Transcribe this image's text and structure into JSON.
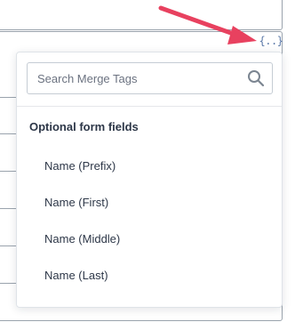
{
  "merge_tags": {
    "trigger_label": "{..}",
    "search": {
      "placeholder": "Search Merge Tags",
      "value": ""
    },
    "group": {
      "label": "Optional form fields",
      "items": [
        {
          "label": "Name (Prefix)"
        },
        {
          "label": "Name (First)"
        },
        {
          "label": "Name (Middle)"
        },
        {
          "label": "Name (Last)"
        }
      ]
    }
  },
  "colors": {
    "annotation_arrow": "#e8415f",
    "trigger": "#5b79a8",
    "text": "#2d3748"
  },
  "icons": {
    "search": "search-icon",
    "annotation": "annotation-arrow-icon"
  }
}
